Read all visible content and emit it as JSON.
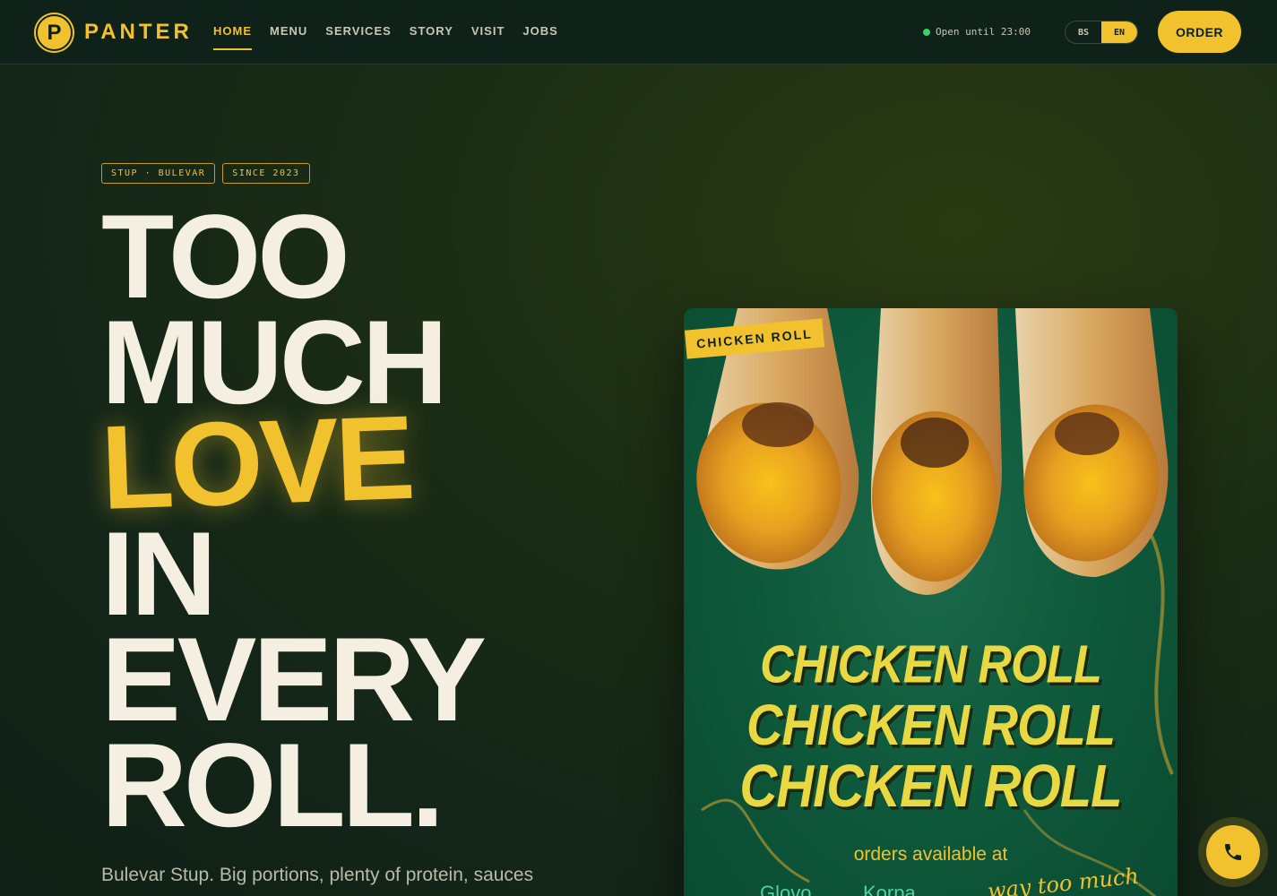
{
  "brand": {
    "logo_letter": "P",
    "name": "PANTER"
  },
  "nav": {
    "items": [
      {
        "label": "HOME",
        "active": true
      },
      {
        "label": "MENU",
        "active": false
      },
      {
        "label": "SERVICES",
        "active": false
      },
      {
        "label": "STORY",
        "active": false
      },
      {
        "label": "VISIT",
        "active": false
      },
      {
        "label": "JOBS",
        "active": false
      }
    ]
  },
  "status": {
    "text": "Open until 23:00",
    "color": "#3ccf6b"
  },
  "language": {
    "options": [
      "BS",
      "EN"
    ],
    "selected": "EN"
  },
  "order_button": {
    "label": "ORDER"
  },
  "hero": {
    "tags": [
      "STUP · BULEVAR",
      "SINCE 2023"
    ],
    "headline": [
      "TOO",
      "MUCH",
      "LOVE",
      "IN",
      "EVERY",
      "ROLL."
    ],
    "lede": "Bulevar Stup. Big portions, plenty of protein, sauces"
  },
  "poster": {
    "badge": "CHICKEN ROLL",
    "title_lines": [
      "CHICKEN ROLL",
      "CHICKEN ROLL",
      "CHICKEN ROLL"
    ],
    "subtitle": "orders available at",
    "partner_1": "Glovo",
    "partner_2": "Korpa",
    "script": "way too much love"
  },
  "colors": {
    "accent": "#f2c12e",
    "background": "#132618",
    "text": "#f5efe2"
  },
  "icons": {
    "call": "phone-icon"
  }
}
